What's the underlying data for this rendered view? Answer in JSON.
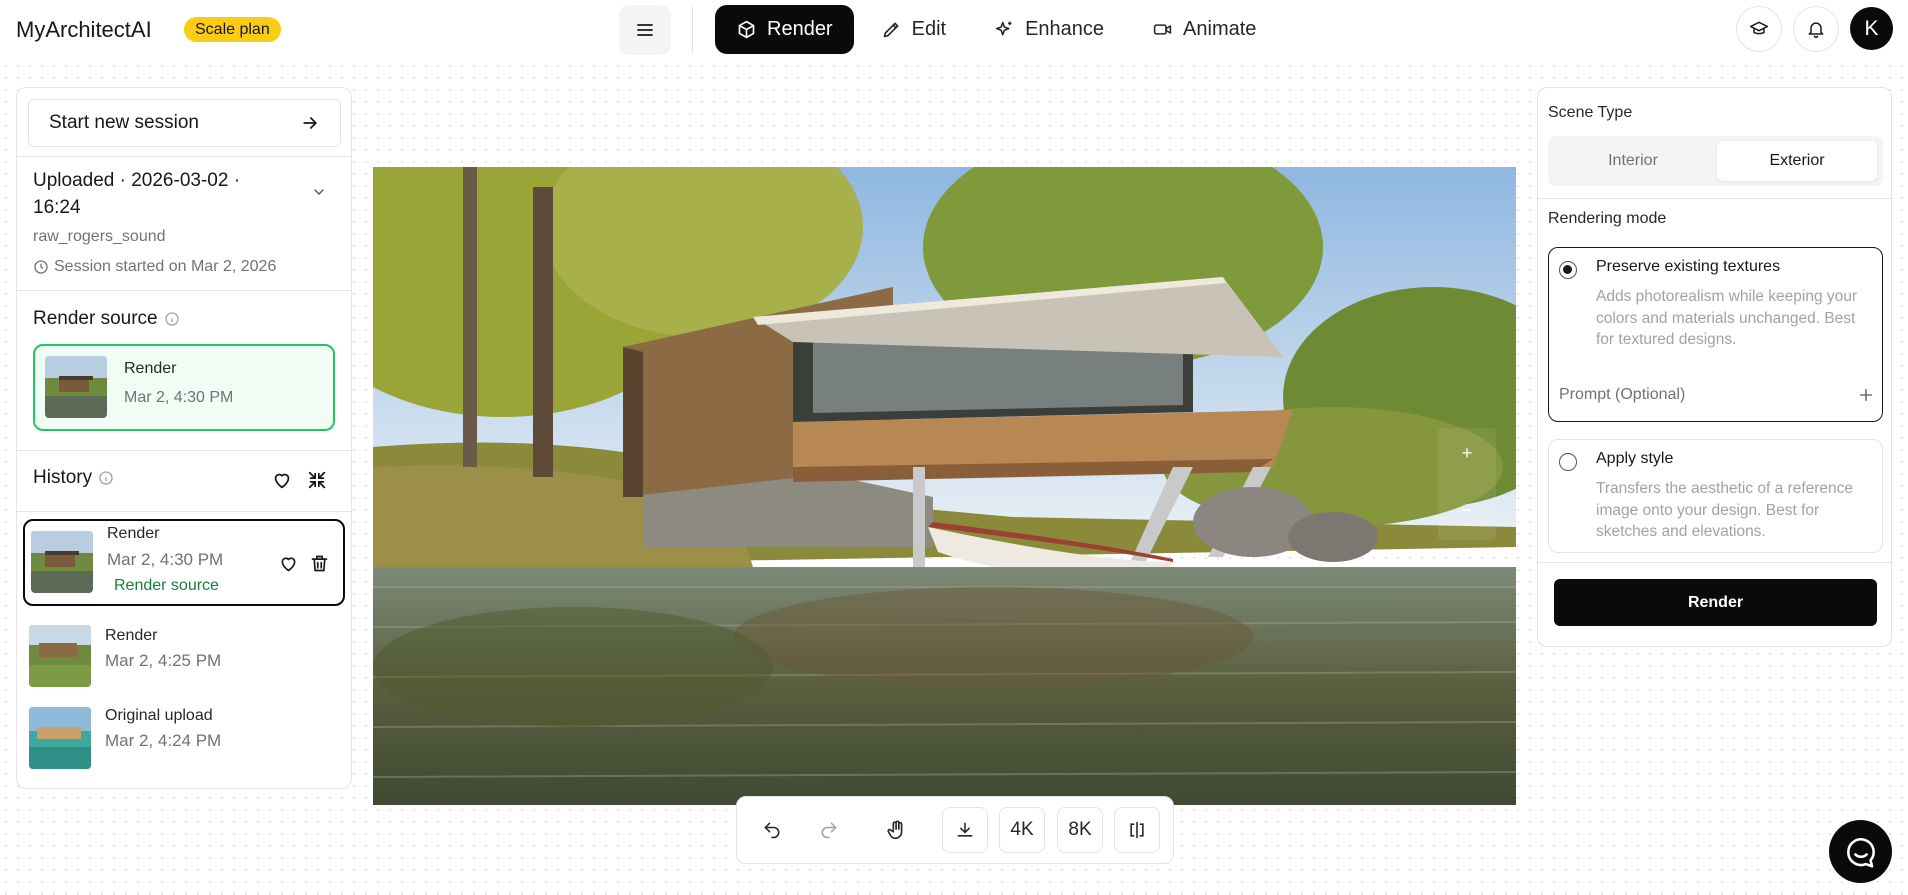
{
  "app": {
    "brand": "MyArchitectAI",
    "plan": "Scale plan",
    "user_initial": "K"
  },
  "modes": [
    {
      "label": "Render",
      "icon": "cube-icon",
      "active": true
    },
    {
      "label": "Edit",
      "icon": "pencil-icon",
      "active": false
    },
    {
      "label": "Enhance",
      "icon": "sparkle-icon",
      "active": false
    },
    {
      "label": "Animate",
      "icon": "video-icon",
      "active": false
    }
  ],
  "left": {
    "new_session": "Start new session",
    "upload_title": "Uploaded · 2026-03-02 · 16:24",
    "upload_file": "raw_rogers_sound",
    "session_started": "Session started on Mar 2, 2026",
    "render_source_title": "Render source",
    "render_source": {
      "label": "Render",
      "time": "Mar 2, 4:30 PM"
    },
    "history_title": "History",
    "history": [
      {
        "label": "Render",
        "time": "Mar 2, 4:30 PM",
        "badge": "Render source",
        "selected": true
      },
      {
        "label": "Render",
        "time": "Mar 2, 4:25 PM"
      },
      {
        "label": "Original upload",
        "time": "Mar 2, 4:24 PM"
      }
    ]
  },
  "canvas": {
    "zoom_in": "+",
    "zoom_out": "−"
  },
  "toolbar": {
    "res_4k": "4K",
    "res_8k": "8K"
  },
  "right": {
    "scene_type_label": "Scene Type",
    "scene_options": [
      "Interior",
      "Exterior"
    ],
    "scene_selected": "Exterior",
    "rendering_mode_label": "Rendering mode",
    "mode_preserve": {
      "title": "Preserve existing textures",
      "desc": "Adds photorealism while keeping your colors and materials unchanged. Best for textured designs."
    },
    "prompt_label": "Prompt (Optional)",
    "mode_style": {
      "title": "Apply style",
      "desc": "Transfers the aesthetic of a reference image onto your design. Best for sketches and elevations."
    },
    "render_button": "Render"
  },
  "colors": {
    "accent": "#0a0a0a",
    "plan_badge": "#facc15",
    "source_green": "#22c55e"
  }
}
